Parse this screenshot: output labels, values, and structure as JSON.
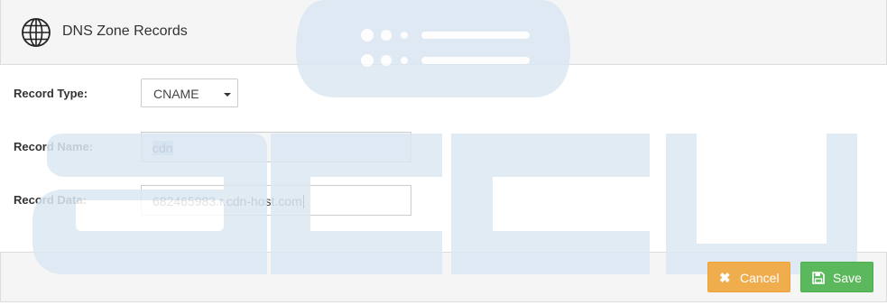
{
  "header": {
    "title": "DNS Zone Records",
    "icon": "globe-icon"
  },
  "form": {
    "record_type": {
      "label": "Record Type:",
      "value": "CNAME"
    },
    "record_name": {
      "label": "Record Name:",
      "value": "cdn"
    },
    "record_data": {
      "label": "Record Data:",
      "value": "682465983.r.cdn-host.com"
    }
  },
  "footer": {
    "cancel_label": "Cancel",
    "cancel_icon": "close-icon",
    "save_label": "Save",
    "save_icon": "floppy-disk-icon"
  },
  "watermark": {
    "text": "accu"
  },
  "colors": {
    "cancel": "#f0ad4e",
    "save": "#5cb85c",
    "watermark": "#dce8f3",
    "panel_bg": "#f5f5f5"
  }
}
